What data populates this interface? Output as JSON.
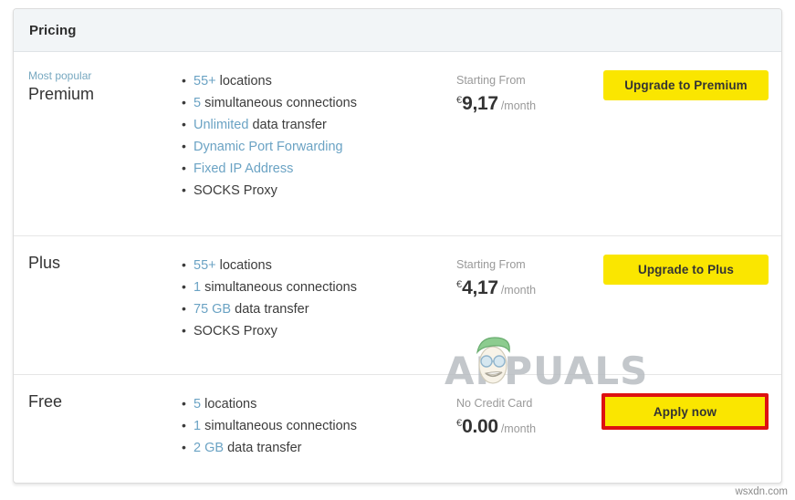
{
  "header": {
    "title": "Pricing"
  },
  "plans": [
    {
      "badge": "Most popular",
      "name": "Premium",
      "features": [
        {
          "highlight": "55+",
          "rest": " locations"
        },
        {
          "highlight": "5",
          "rest": " simultaneous connections"
        },
        {
          "highlight": "Unlimited",
          "rest": " data transfer"
        },
        {
          "highlight": "Dynamic Port Forwarding",
          "rest": ""
        },
        {
          "highlight": "Fixed IP Address",
          "rest": ""
        },
        {
          "highlight": "",
          "rest": "SOCKS Proxy"
        }
      ],
      "price_caption": "Starting From",
      "currency": "€",
      "amount": "9,17",
      "period": "/month",
      "button_label": "Upgrade to Premium",
      "button_highlighted": false
    },
    {
      "badge": "",
      "name": "Plus",
      "features": [
        {
          "highlight": "55+",
          "rest": " locations"
        },
        {
          "highlight": "1",
          "rest": " simultaneous connections"
        },
        {
          "highlight": "75 GB",
          "rest": " data transfer"
        },
        {
          "highlight": "",
          "rest": "SOCKS Proxy"
        }
      ],
      "price_caption": "Starting From",
      "currency": "€",
      "amount": "4,17",
      "period": "/month",
      "button_label": "Upgrade to Plus",
      "button_highlighted": false
    },
    {
      "badge": "",
      "name": "Free",
      "features": [
        {
          "highlight": "5",
          "rest": " locations"
        },
        {
          "highlight": "1",
          "rest": " simultaneous connections"
        },
        {
          "highlight": "2 GB",
          "rest": " data transfer"
        }
      ],
      "price_caption": "No Credit Card",
      "currency": "€",
      "amount": "0.00",
      "period": "/month",
      "button_label": "Apply now",
      "button_highlighted": true
    }
  ],
  "watermark": {
    "text": "APPUALS"
  },
  "site_mark": "wsxdn.com",
  "colors": {
    "button": "#FAE600",
    "highlight_border": "#DD1111",
    "link": "#6BA3C4",
    "badge": "#77A8C0",
    "header_bg": "#F2F5F7"
  }
}
